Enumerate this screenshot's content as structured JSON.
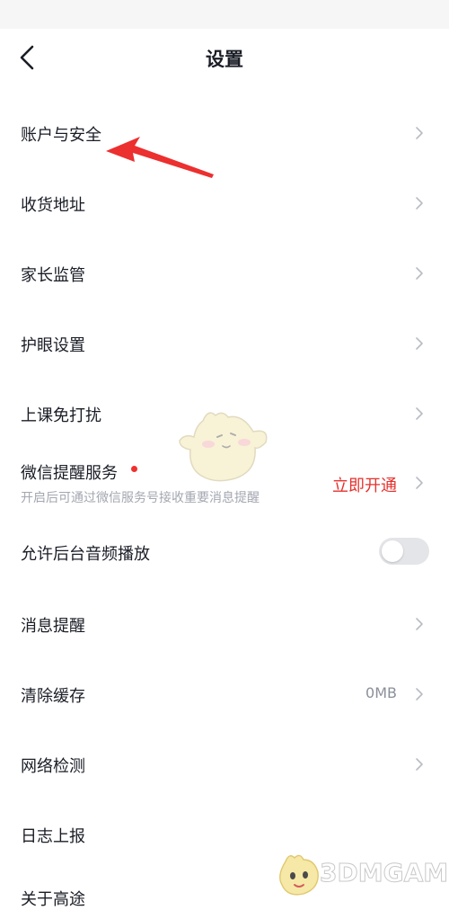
{
  "header": {
    "title": "设置",
    "back_icon": "chevron-left-icon"
  },
  "rows": [
    {
      "label": "账户与安全"
    },
    {
      "label": "收货地址"
    },
    {
      "label": "家长监管"
    },
    {
      "label": "护眼设置"
    },
    {
      "label": "上课免打扰"
    },
    {
      "label": "微信提醒服务",
      "sub": "开启后可通过微信服务号接收重要消息提醒",
      "action": "立即开通"
    },
    {
      "label": "允许后台音频播放",
      "toggle_on": false
    },
    {
      "label": "消息提醒"
    },
    {
      "label": "清除缓存",
      "value": "0MB"
    },
    {
      "label": "网络检测"
    },
    {
      "label": "日志上报"
    },
    {
      "label": "关于高途"
    }
  ],
  "watermark": {
    "text": "3DMGAME"
  },
  "colors": {
    "accent_red": "#e5322d",
    "dot_red": "#f0302f",
    "text": "#1a1d26",
    "sub_text": "#a3a7b0"
  }
}
